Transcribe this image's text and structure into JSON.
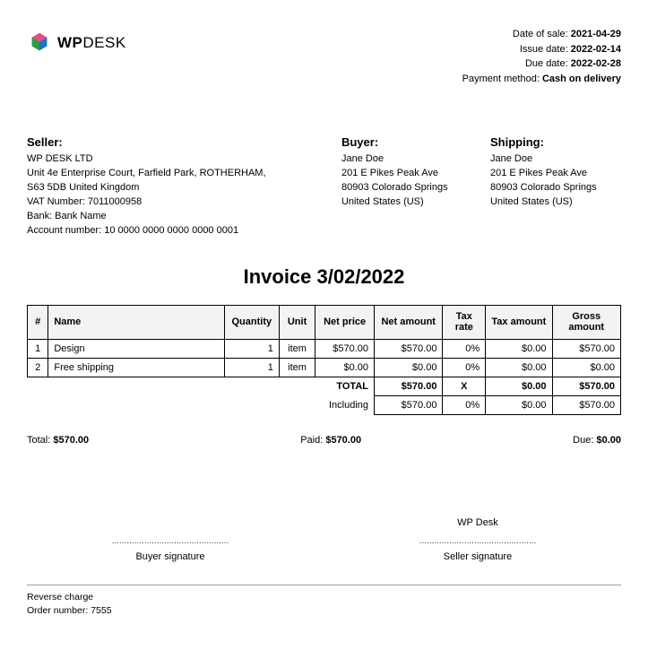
{
  "meta": {
    "date_of_sale_label": "Date of sale:",
    "date_of_sale": "2021-04-29",
    "issue_date_label": "Issue date:",
    "issue_date": "2022-02-14",
    "due_date_label": "Due date:",
    "due_date": "2022-02-28",
    "payment_method_label": "Payment method:",
    "payment_method": "Cash on delivery"
  },
  "logo": {
    "wp": "WP",
    "desk": "DESK"
  },
  "seller": {
    "heading": "Seller:",
    "name": "WP DESK LTD",
    "addr1": "Unit 4e Enterprise Court, Farfield Park, ROTHERHAM,",
    "addr2": "S63 5DB United Kingdom",
    "vat": "VAT Number: 7011000958",
    "bank": "Bank: Bank Name",
    "acct": "Account number: 10 0000 0000 0000 0000 0001"
  },
  "buyer": {
    "heading": "Buyer:",
    "name": "Jane Doe",
    "addr1": "201 E Pikes Peak Ave",
    "addr2": "80903 Colorado Springs",
    "addr3": "United States (US)"
  },
  "shipping": {
    "heading": "Shipping:",
    "name": "Jane Doe",
    "addr1": "201 E Pikes Peak Ave",
    "addr2": "80903 Colorado Springs",
    "addr3": "United States (US)"
  },
  "title": "Invoice 3/02/2022",
  "columns": {
    "num": "#",
    "name": "Name",
    "qty": "Quantity",
    "unit": "Unit",
    "net_price": "Net price",
    "net_amount": "Net amount",
    "tax_rate": "Tax rate",
    "tax_amount": "Tax amount",
    "gross_amount": "Gross amount"
  },
  "rows": [
    {
      "num": "1",
      "name": "Design",
      "qty": "1",
      "unit": "item",
      "net_price": "$570.00",
      "net_amount": "$570.00",
      "tax_rate": "0%",
      "tax_amount": "$0.00",
      "gross": "$570.00"
    },
    {
      "num": "2",
      "name": "Free shipping",
      "qty": "1",
      "unit": "item",
      "net_price": "$0.00",
      "net_amount": "$0.00",
      "tax_rate": "0%",
      "tax_amount": "$0.00",
      "gross": "$0.00"
    }
  ],
  "total_row": {
    "label": "TOTAL",
    "net_amount": "$570.00",
    "tax_rate": "X",
    "tax_amount": "$0.00",
    "gross": "$570.00"
  },
  "including_row": {
    "label": "Including",
    "net_amount": "$570.00",
    "tax_rate": "0%",
    "tax_amount": "$0.00",
    "gross": "$570.00"
  },
  "summary": {
    "total_label": "Total:",
    "total": "$570.00",
    "paid_label": "Paid:",
    "paid": "$570.00",
    "due_label": "Due:",
    "due": "$0.00"
  },
  "signatures": {
    "seller_name": "WP Desk",
    "dots": "...............................................",
    "buyer_label": "Buyer signature",
    "seller_label": "Seller signature"
  },
  "footer": {
    "line1": "Reverse charge",
    "line2": "Order number: 7555"
  }
}
